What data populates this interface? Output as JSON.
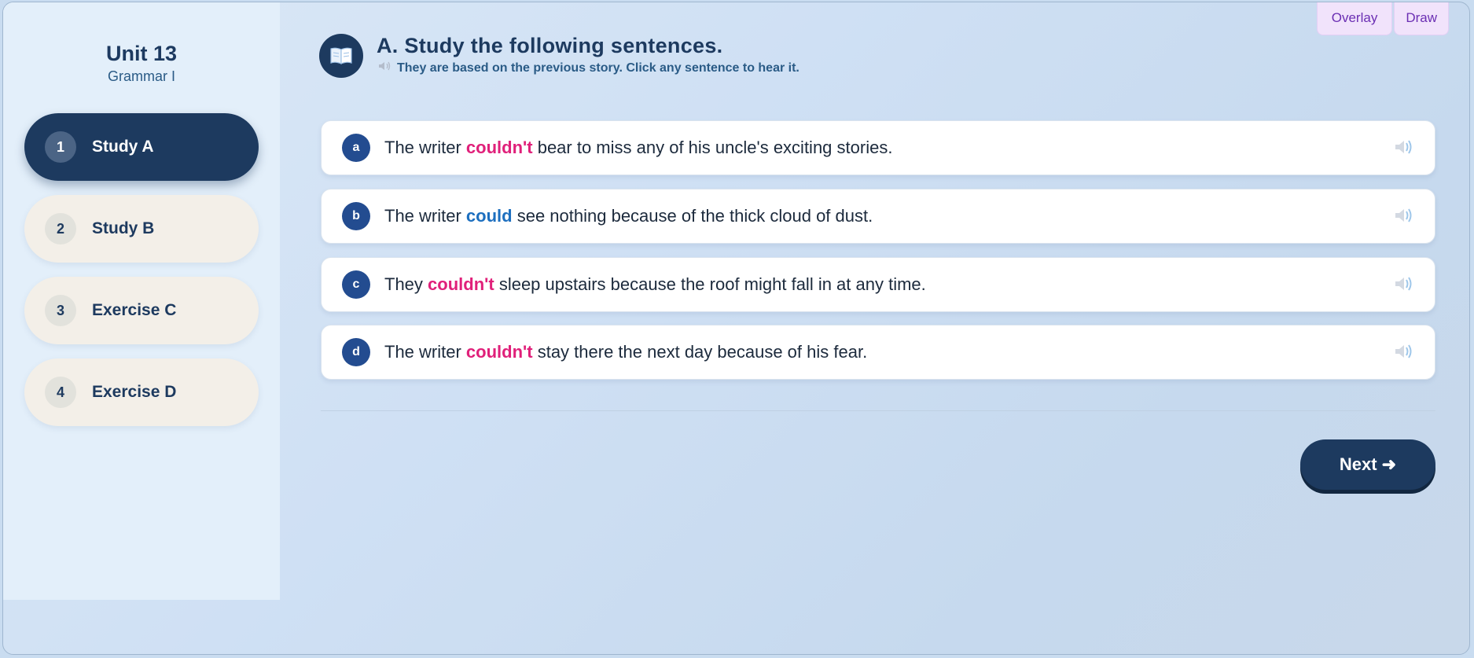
{
  "topbar": {
    "overlay_label": "Overlay",
    "draw_label": "Draw"
  },
  "sidebar": {
    "unit_title": "Unit 13",
    "unit_subtitle": "Grammar I",
    "items": [
      {
        "number": "1",
        "label": "Study A",
        "active": true
      },
      {
        "number": "2",
        "label": "Study B",
        "active": false
      },
      {
        "number": "3",
        "label": "Exercise C",
        "active": false
      },
      {
        "number": "4",
        "label": "Exercise D",
        "active": false
      }
    ]
  },
  "header": {
    "icon": "book-icon",
    "title": "A. Study the following sentences.",
    "subtitle_icon": "speaker-icon",
    "subtitle": "They are based on the previous story. Click any sentence to hear it."
  },
  "sentences": [
    {
      "letter": "a",
      "before": "The writer ",
      "highlight": "couldn't",
      "after": " bear to miss any of his uncle's exciting stories.",
      "highlight_color": "#e0207a"
    },
    {
      "letter": "b",
      "before": "The writer ",
      "highlight": "could",
      "after": " see nothing because of the thick cloud of dust.",
      "highlight_color": "#1d6fbf"
    },
    {
      "letter": "c",
      "before": "They ",
      "highlight": "couldn't",
      "after": " sleep upstairs because the roof might fall in at any time.",
      "highlight_color": "#e0207a"
    },
    {
      "letter": "d",
      "before": "The writer ",
      "highlight": "couldn't",
      "after": " stay there the next day because of his fear.",
      "highlight_color": "#e0207a"
    }
  ],
  "next_label": "Next ➜",
  "colors": {
    "primary": "#1d3a5f",
    "pink": "#e0207a",
    "blue": "#1d6fbf"
  }
}
